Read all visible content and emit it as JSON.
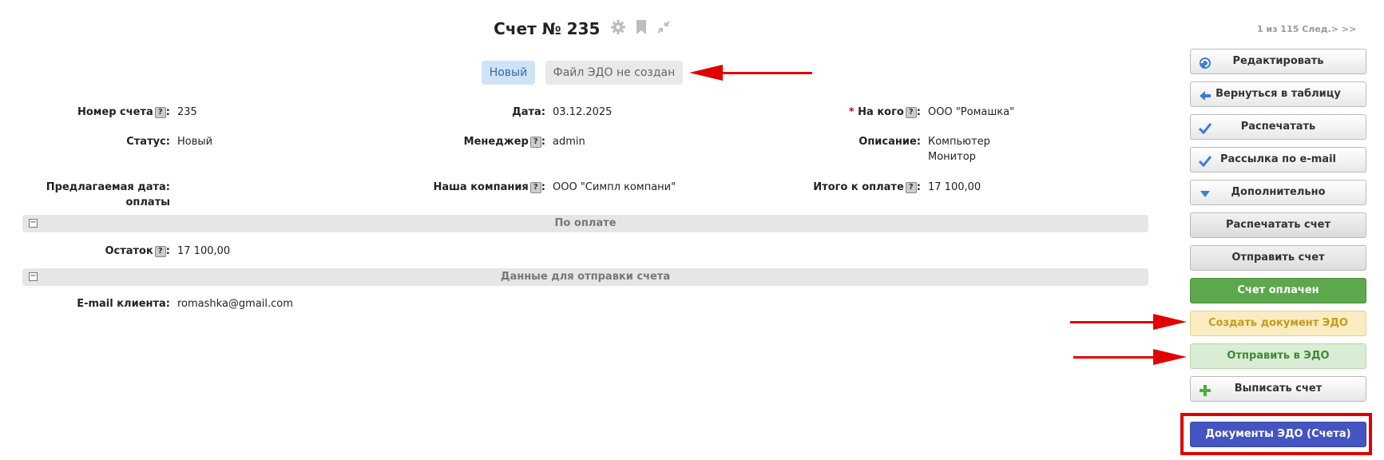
{
  "header": {
    "title": "Счет № 235",
    "pager": "1 из 115 След.> >>"
  },
  "badges": {
    "status": "Новый",
    "edo_file": "Файл ЭДО не создан"
  },
  "fields": {
    "invoice_number": {
      "label": "Номер счета",
      "value": "235"
    },
    "date": {
      "label": "Дата:",
      "value": "03.12.2025"
    },
    "recipient": {
      "required_mark": "*",
      "label": "На кого",
      "value": "ООО \"Ромашка\""
    },
    "status": {
      "label": "Статус:",
      "value": "Новый"
    },
    "manager": {
      "label": "Менеджер",
      "value": "admin"
    },
    "description": {
      "label": "Описание:",
      "value_line1": "Компьютер",
      "value_line2": "Монитор"
    },
    "proposed_date": {
      "label_line1": "Предлагаемая дата:",
      "label_line2": "оплаты"
    },
    "our_company": {
      "label": "Наша компания",
      "value": "ООО \"Симпл компани\""
    },
    "total": {
      "label": "Итого к оплате",
      "value": "17 100,00"
    },
    "balance": {
      "label": "Остаток",
      "value": "17 100,00"
    },
    "client_email": {
      "label": "E-mail клиента:",
      "value": "romashka@gmail.com"
    }
  },
  "sections": {
    "payment": "По оплате",
    "send_data": "Данные для отправки счета"
  },
  "actions": {
    "edit": "Редактировать",
    "back": "Вернуться в таблицу",
    "print": "Распечатать",
    "email": "Рассылка по e-mail",
    "more": "Дополнительно",
    "print_invoice": "Распечатать счет",
    "send_invoice": "Отправить счет",
    "paid": "Счет оплачен",
    "create_edo": "Создать документ ЭДО",
    "send_edo": "Отправить в ЭДО",
    "issue_invoice": "Выписать счет",
    "edo_docs": "Документы ЭДО (Счета)"
  },
  "icons": {
    "settings": "gear-icon",
    "bookmark": "bookmark-icon",
    "collapse": "collapse-icon",
    "help": "help-icon",
    "edit": "refresh-icon",
    "back": "arrow-left-icon",
    "check": "check-icon",
    "dropdown": "triangle-down-icon",
    "add": "plus-icon"
  },
  "colors": {
    "green_button": "#5da84c",
    "yellow_button": "#f8ecc0",
    "light_green_button": "#d9ecd4",
    "blue_button": "#4455c2",
    "highlight": "#e00000",
    "badge_new": "#cfe3f7"
  }
}
